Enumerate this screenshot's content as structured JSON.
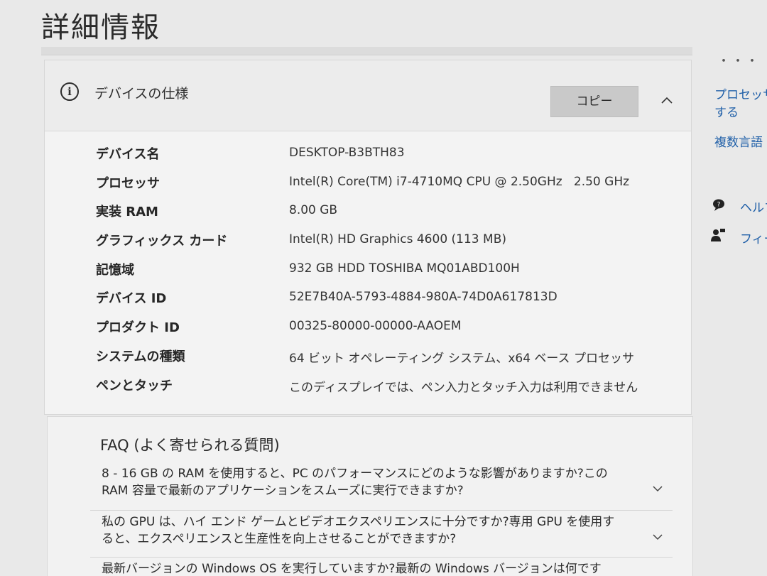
{
  "page": {
    "title": "詳細情報",
    "top_dots": "・・・"
  },
  "device_specs": {
    "title": "デバイスの仕様",
    "info_icon": "info-icon",
    "copy_label": "コピー",
    "collapse_icon": "chevron-up-icon",
    "rows": [
      {
        "label": "デバイス名",
        "value": "DESKTOP-B3BTH83"
      },
      {
        "label": "プロセッサ",
        "value": "Intel(R) Core(TM) i7-4710MQ CPU @ 2.50GHz   2.50 GHz"
      },
      {
        "label": "実装 RAM",
        "value": "8.00 GB"
      },
      {
        "label": "グラフィックス カード",
        "value": "Intel(R) HD Graphics 4600 (113 MB)"
      },
      {
        "label": "記憶域",
        "value": "932 GB HDD TOSHIBA MQ01ABD100H"
      },
      {
        "label": "デバイス ID",
        "value": "52E7B40A-5793-4884-980A-74D0A617813D"
      },
      {
        "label": "プロダクト ID",
        "value": "00325-80000-00000-AAOEM"
      },
      {
        "label": "システムの種類",
        "value": "64 ビット オペレーティング システム、x64 ベース プロセッサ"
      },
      {
        "label": "ペンとタッチ",
        "value": "このディスプレイでは、ペン入力とタッチ入力は利用できません"
      }
    ]
  },
  "faq": {
    "title": "FAQ (よく寄せられる質問)",
    "items": [
      {
        "line1": "8 - 16 GB の RAM を使用すると、PC のパフォーマンスにどのような影響がありますか?この",
        "line2": "RAM 容量で最新のアプリケーションをスムーズに実行できますか?"
      },
      {
        "line1": "私の GPU は、ハイ エンド ゲームとビデオエクスペリエンスに十分ですか?専用 GPU を使用す",
        "line2": "ると、エクスペリエンスと生産性を向上させることができますか?"
      },
      {
        "line1": "最新バージョンの Windows OS を実行していますか?最新の Windows バージョンは何です",
        "line2": ""
      }
    ]
  },
  "sidebar": {
    "link_processor_line1": "プロセッサ",
    "link_processor_line2": "する",
    "link_languages": "複数言語",
    "help_label": "ヘルプ",
    "feedback_label": "フィー",
    "help_icon": "help-chat-icon",
    "feedback_icon": "feedback-person-icon"
  },
  "colors": {
    "link": "#1f5fa8",
    "copy_button": "#c9c9c9",
    "background": "#e9e9e9"
  }
}
